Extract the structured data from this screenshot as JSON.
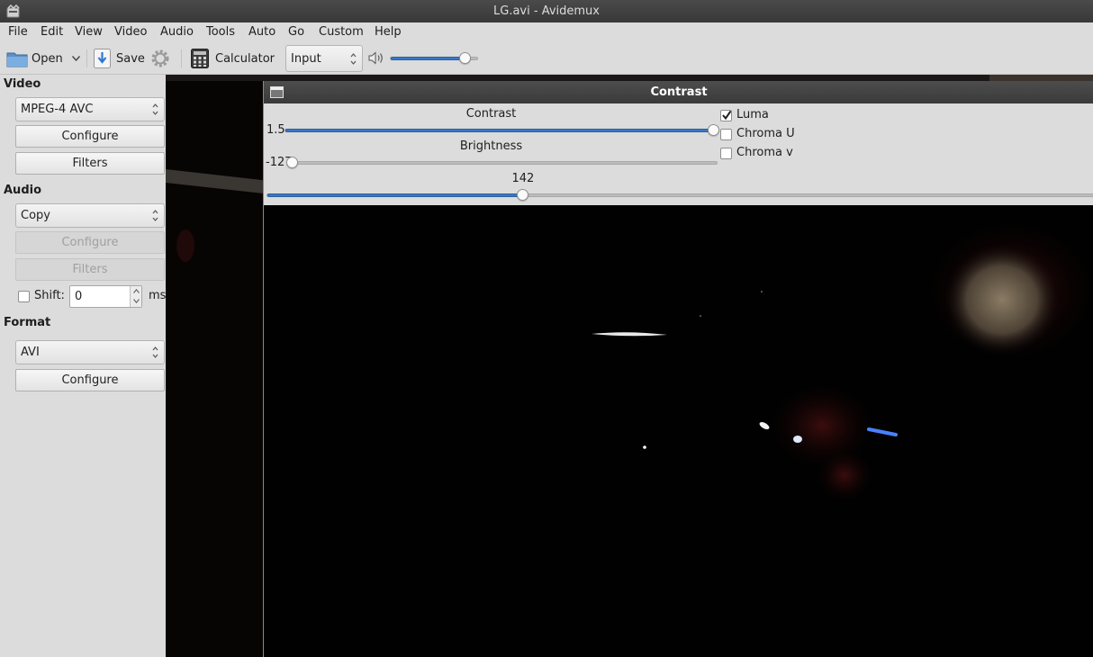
{
  "window": {
    "title": "LG.avi - Avidemux"
  },
  "menu": [
    "File",
    "Edit",
    "View",
    "Video",
    "Audio",
    "Tools",
    "Auto",
    "Go",
    "Custom",
    "Help"
  ],
  "toolbar": {
    "open_label": "Open",
    "save_label": "Save",
    "calculator_label": "Calculator",
    "source_select": "Input",
    "volume_level": 0.85
  },
  "left_panel": {
    "video": {
      "heading": "Video",
      "codec": "MPEG-4 AVC",
      "configure": "Configure",
      "filters": "Filters"
    },
    "audio": {
      "heading": "Audio",
      "codec": "Copy",
      "configure": "Configure",
      "filters": "Filters",
      "shift_label": "Shift:",
      "shift_value": "0",
      "shift_unit": "ms"
    },
    "format": {
      "heading": "Format",
      "container": "AVI",
      "configure": "Configure"
    }
  },
  "contrast_dialog": {
    "title": "Contrast",
    "contrast": {
      "label": "Contrast",
      "value_text": "1.5",
      "fraction": 1.0
    },
    "brightness": {
      "label": "Brightness",
      "value_text": "-127",
      "fraction": 0.0
    },
    "position": {
      "value_text": "142",
      "fraction": 0.31
    },
    "channels": [
      {
        "label": "Luma",
        "checked": true
      },
      {
        "label": "Chroma U",
        "checked": false
      },
      {
        "label": "Chroma v",
        "checked": false
      }
    ]
  },
  "colors": {
    "accent": "#3a78c6",
    "titlebar": "#3f3f3f",
    "panel": "#dcdcdc"
  }
}
